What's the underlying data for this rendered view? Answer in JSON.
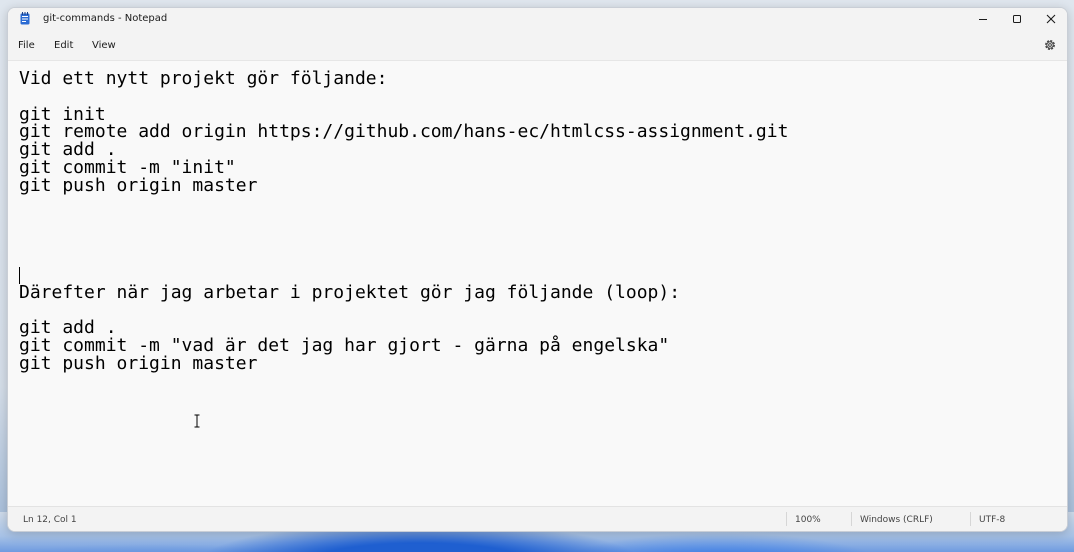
{
  "window": {
    "title": "git-commands - Notepad"
  },
  "title_controls": {
    "minimize_icon": "minimize-icon",
    "maximize_icon": "maximize-icon",
    "close_icon": "close-icon"
  },
  "menu": {
    "file": "File",
    "edit": "Edit",
    "view": "View",
    "settings_icon": "gear-icon"
  },
  "editor": {
    "content": "Vid ett nytt projekt gör följande:\n\ngit init\ngit remote add origin https://github.com/hans-ec/htmlcss-assignment.git\ngit add .\ngit commit -m \"init\"\ngit push origin master\n\n\n\n\n\nDärefter när jag arbetar i projektet gör jag följande (loop):\n\ngit add .\ngit commit -m \"vad är det jag har gjort - gärna på engelska\"\ngit push origin master"
  },
  "status": {
    "position": "Ln 12, Col 1",
    "zoom": "100%",
    "line_ending": "Windows (CRLF)",
    "encoding": "UTF-8"
  },
  "colors": {
    "text": "#000000",
    "chrome": "#f3f3f3",
    "editor_bg": "#f9f9f9",
    "icon_blue": "#2b6bd3"
  }
}
